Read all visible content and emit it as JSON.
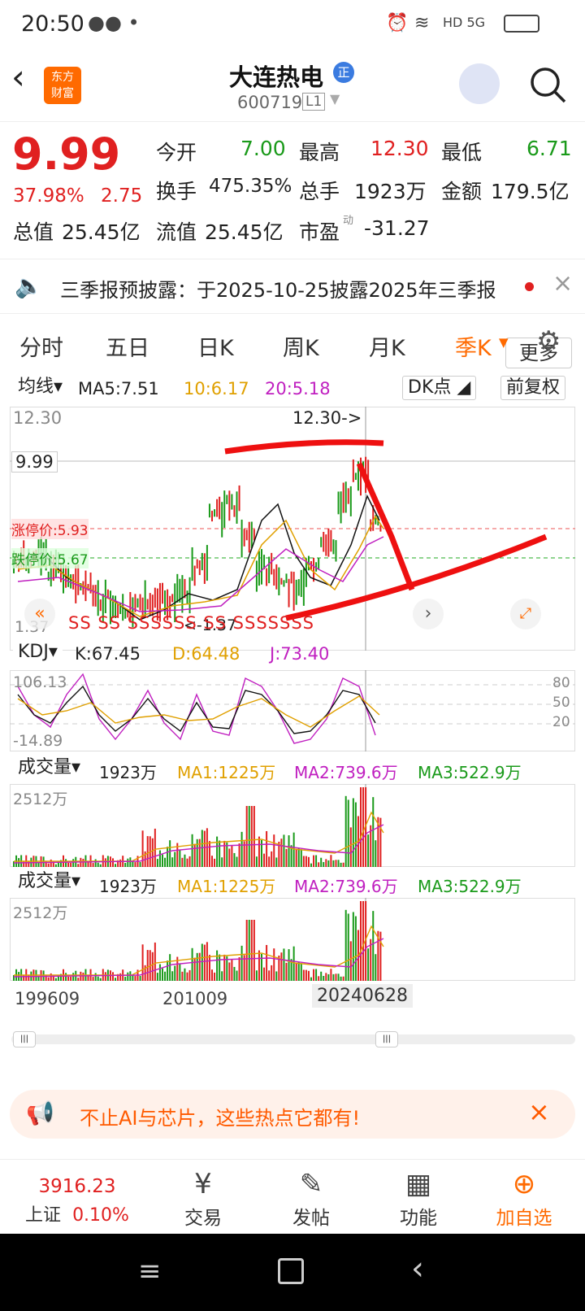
{
  "status": {
    "time": "20:50",
    "right": "HD 5G"
  },
  "header": {
    "title": "大连热电",
    "badge": "正",
    "code": "600719",
    "level": "L1",
    "logo_line1": "东方",
    "logo_line2": "财富"
  },
  "quote": {
    "price": "9.99",
    "pct": "37.98%",
    "chg": "2.75",
    "open_label": "今开",
    "open": "7.00",
    "high_label": "最高",
    "high": "12.30",
    "low_label": "最低",
    "low": "6.71",
    "turnover_label": "换手",
    "turnover": "475.35%",
    "vol_label": "总手",
    "vol": "1923万",
    "amount_label": "金额",
    "amount": "179.5亿",
    "mcap_label": "总值",
    "mcap": "25.45亿",
    "float_label": "流值",
    "float": "25.45亿",
    "pe_label": "市盈",
    "pe_sup": "动",
    "pe": "-31.27",
    "more": "更多"
  },
  "notice": {
    "text": "三季报预披露：于2025-10-25披露2025年三季报"
  },
  "tabs": [
    "分时",
    "五日",
    "日K",
    "周K",
    "月K",
    "季K"
  ],
  "chart": {
    "ma_sel": "均线",
    "ma5": "MA5:7.51",
    "ma10": "10:6.17",
    "ma20": "20:5.18",
    "dk": "DK点",
    "fq": "前复权",
    "top_price": "12.30",
    "cur_price": "9.99",
    "high_mark": "12.30->",
    "lim_up": "涨停价:5.93",
    "lim_dn": "跌停价:5.67",
    "low_mark": "<-1.37",
    "ylow": "1.37",
    "s_marks": "SS  SS  SSSSSS  SS  SSSSSSS",
    "kdj_sel": "KDJ",
    "k": "K:67.45",
    "d": "D:64.48",
    "j": "J:73.40",
    "kdj_top": "106.13",
    "kdj_bot": "-14.89",
    "kdj_80": "80",
    "kdj_50": "50",
    "kdj_20": "20",
    "vol_sel": "成交量",
    "vol_val": "1923万",
    "vma1": "MA1:1225万",
    "vma2": "MA2:739.6万",
    "vma3": "MA3:522.9万",
    "vol_top": "2512万",
    "x1": "199609",
    "x2": "201009",
    "x3": "20240628"
  },
  "banner": {
    "text": "不止AI与芯片，这些热点它都有!"
  },
  "bottom": {
    "index_val": "3916.23",
    "index_name": "上证",
    "index_pct": "0.10%",
    "trade": "交易",
    "post": "发帖",
    "func": "功能",
    "add": "加自选"
  },
  "colors": {
    "up": "#e02020",
    "down": "#1a9a1a",
    "accent": "#ff6a00"
  }
}
